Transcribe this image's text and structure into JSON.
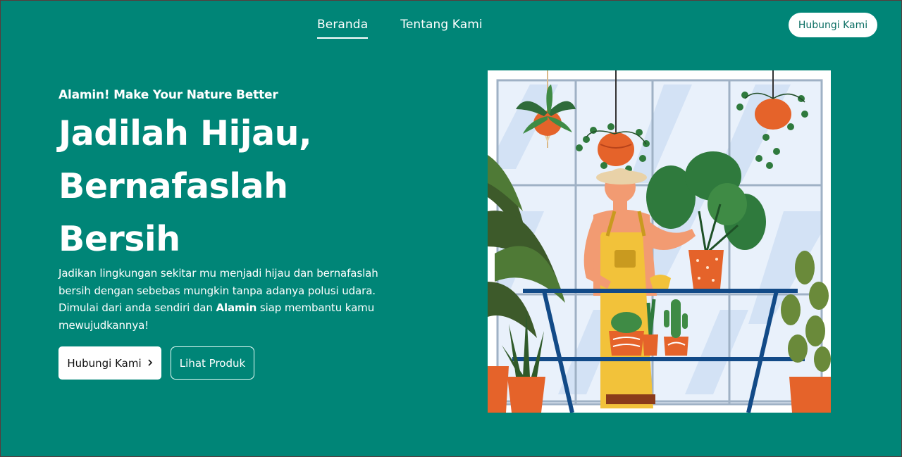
{
  "nav": {
    "links": [
      {
        "label": "Beranda",
        "active": true
      },
      {
        "label": "Tentang Kami",
        "active": false
      }
    ],
    "cta_label": "Hubungi Kami"
  },
  "hero": {
    "eyebrow": "Alamin! Make Your Nature Better",
    "headline": [
      "Jadilah Hijau,",
      "Bernafaslah",
      "Bersih"
    ],
    "description_start": "Jadikan lingkungan sekitar mu menjadi hijau dan bernafaslah bersih dengan sebebas mungkin tanpa adanya polusi udara. Dimulai dari anda sendiri dan ",
    "description_bold": "Alamin",
    "description_end": " siap membantu kamu mewujudkannya!",
    "primary_button": "Hubungi Kami",
    "primary_button_icon": "chevron-right-icon",
    "secondary_button": "Lihat Produk"
  },
  "colors": {
    "background": "#008577",
    "button_text_accent": "#0b6e63",
    "white": "#ffffff"
  }
}
